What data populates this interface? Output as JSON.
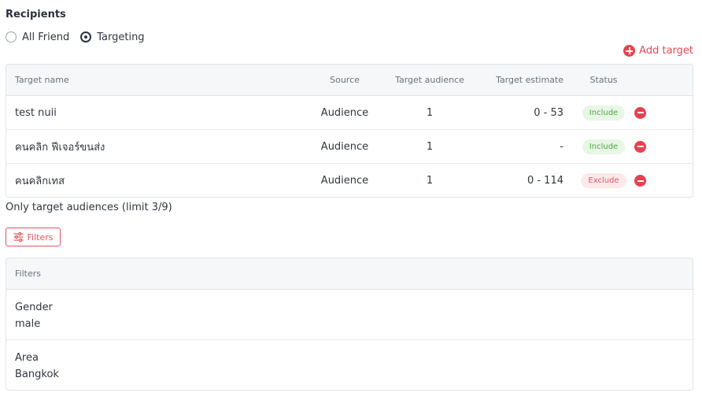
{
  "recipients": {
    "title": "Recipients",
    "options": [
      {
        "label": "All Friend",
        "checked": false
      },
      {
        "label": "Targeting",
        "checked": true
      }
    ]
  },
  "add_target": {
    "label": "Add target",
    "icon": "plus-circle-icon"
  },
  "targets_table": {
    "headers": {
      "name": "Target name",
      "source": "Source",
      "audience": "Target audience",
      "estimate": "Target estimate",
      "status": "Status"
    },
    "rows": [
      {
        "name": "test nuii",
        "source": "Audience",
        "audience": "1",
        "estimate": "0 - 53",
        "status": "Include"
      },
      {
        "name": "คนคลิก ฟีเจอร์ขนส่ง",
        "source": "Audience",
        "audience": "1",
        "estimate": "-",
        "status": "Include"
      },
      {
        "name": "คนคลิกเทส",
        "source": "Audience",
        "audience": "1",
        "estimate": "0 - 114",
        "status": "Exclude"
      }
    ]
  },
  "limit_note": "Only target audiences (limit 3/9)",
  "filters_button": {
    "label": "Filters",
    "icon": "sliders-icon"
  },
  "filters_table": {
    "header": "Filters",
    "rows": [
      {
        "label": "Gender",
        "value": "male"
      },
      {
        "label": "Area",
        "value": "Bangkok"
      }
    ]
  },
  "colors": {
    "accent_red": "#e8414e",
    "include_green": "#4fa944",
    "exclude_red": "#e05a64",
    "text_dark": "#2f3640"
  }
}
